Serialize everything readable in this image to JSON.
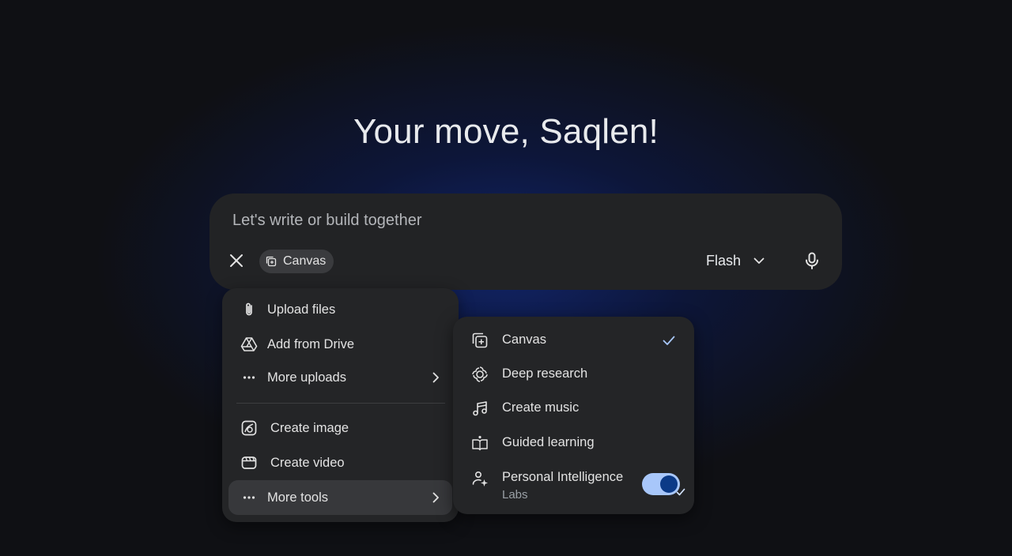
{
  "greeting": "Your move, Saqlen!",
  "prompt": {
    "placeholder": "Let's write or build together",
    "value": "",
    "chip_label": "Canvas",
    "model_label": "Flash"
  },
  "menu_left": {
    "items": [
      {
        "label": "Upload files",
        "icon": "paperclip-icon"
      },
      {
        "label": "Add from Drive",
        "icon": "drive-icon"
      },
      {
        "label": "More uploads",
        "icon": "more-horiz-icon",
        "has_submenu": true
      },
      {
        "label": "Create image",
        "icon": "image-icon"
      },
      {
        "label": "Create video",
        "icon": "video-icon"
      },
      {
        "label": "More tools",
        "icon": "more-horiz-icon",
        "has_submenu": true,
        "active": true
      }
    ]
  },
  "menu_right": {
    "items": [
      {
        "label": "Canvas",
        "icon": "canvas-icon",
        "checked": true
      },
      {
        "label": "Deep research",
        "icon": "deep-research-icon"
      },
      {
        "label": "Create music",
        "icon": "music-icon"
      },
      {
        "label": "Guided learning",
        "icon": "guided-learning-icon"
      },
      {
        "label": "Personal Intelligence",
        "sublabel": "Labs",
        "icon": "personal-intelligence-icon",
        "toggle_on": true
      }
    ]
  },
  "colors": {
    "background": "#0f1014",
    "glow": "#12266e",
    "surface": "#242527",
    "prompt_surface": "#222325",
    "text": "#e3e3e3",
    "accent": "#a8c7fa",
    "toggle_knob": "#0b3a87"
  }
}
